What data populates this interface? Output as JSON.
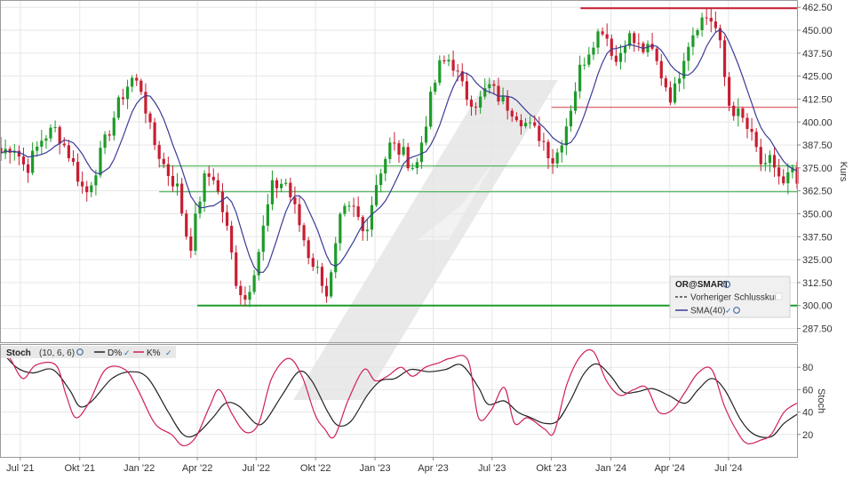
{
  "chart_data": [
    {
      "type": "candlestick",
      "title": "",
      "ylabel": "Kurs",
      "ylim": [
        280,
        466
      ],
      "yticks": [
        287.5,
        300,
        312.5,
        325,
        337.5,
        350,
        362.5,
        375,
        387.5,
        400,
        412.5,
        425,
        437.5,
        450,
        462.5
      ],
      "ytick_labels": [
        "287.50",
        "300.00",
        "312.50",
        "325.00",
        "337.50",
        "350.00",
        "362.50",
        "375.00",
        "387.50",
        "400.00",
        "412.50",
        "425.00",
        "437.50",
        "450.00",
        "462.50"
      ],
      "x_range": [
        "2021-06-01",
        "2024-10-15"
      ],
      "xticks": [
        {
          "date": "2021-07-01",
          "label": "Jul '21"
        },
        {
          "date": "2021-10-01",
          "label": "Okt '21"
        },
        {
          "date": "2022-01-01",
          "label": "Jan '22"
        },
        {
          "date": "2022-04-01",
          "label": "Apr '22"
        },
        {
          "date": "2022-07-01",
          "label": "Jul '22"
        },
        {
          "date": "2022-10-01",
          "label": "Okt '22"
        },
        {
          "date": "2023-01-01",
          "label": "Jan '23"
        },
        {
          "date": "2023-04-01",
          "label": "Apr '23"
        },
        {
          "date": "2023-07-01",
          "label": "Jul '23"
        },
        {
          "date": "2023-10-01",
          "label": "Okt '23"
        },
        {
          "date": "2024-01-01",
          "label": "Jan '24"
        },
        {
          "date": "2024-04-01",
          "label": "Apr '24"
        },
        {
          "date": "2024-07-01",
          "label": "Jul '24"
        }
      ],
      "grid": true,
      "legend": {
        "position": "bottom-right",
        "title": "OR@SMART",
        "items": [
          {
            "name": "Vorheriger Schlusskurs",
            "style": "dashed",
            "color": "#444444"
          },
          {
            "name": "SMA(40)",
            "style": "solid",
            "color": "#3b3b96"
          }
        ]
      },
      "series_colors": {
        "up": "#1e9b2a",
        "down": "#c81e32",
        "sma": "#3b3b96"
      },
      "weekly_close_waypoints": [
        [
          "2021-06-01",
          383
        ],
        [
          "2021-06-20",
          388
        ],
        [
          "2021-07-10",
          374
        ],
        [
          "2021-08-05",
          392
        ],
        [
          "2021-08-25",
          396
        ],
        [
          "2021-09-15",
          382
        ],
        [
          "2021-10-10",
          360
        ],
        [
          "2021-10-25",
          374
        ],
        [
          "2021-11-20",
          400
        ],
        [
          "2021-12-05",
          414
        ],
        [
          "2021-12-20",
          424
        ],
        [
          "2022-01-05",
          418
        ],
        [
          "2022-01-20",
          392
        ],
        [
          "2022-02-10",
          375
        ],
        [
          "2022-03-01",
          364
        ],
        [
          "2022-03-20",
          330
        ],
        [
          "2022-04-10",
          368
        ],
        [
          "2022-04-25",
          372
        ],
        [
          "2022-05-15",
          345
        ],
        [
          "2022-06-01",
          312
        ],
        [
          "2022-06-15",
          303
        ],
        [
          "2022-07-05",
          330
        ],
        [
          "2022-07-25",
          364
        ],
        [
          "2022-08-15",
          368
        ],
        [
          "2022-09-01",
          350
        ],
        [
          "2022-09-20",
          328
        ],
        [
          "2022-10-10",
          315
        ],
        [
          "2022-10-20",
          305
        ],
        [
          "2022-11-10",
          350
        ],
        [
          "2022-12-01",
          352
        ],
        [
          "2022-12-15",
          338
        ],
        [
          "2023-01-05",
          370
        ],
        [
          "2023-01-25",
          388
        ],
        [
          "2023-02-15",
          382
        ],
        [
          "2023-03-05",
          374
        ],
        [
          "2023-03-25",
          408
        ],
        [
          "2023-04-10",
          430
        ],
        [
          "2023-04-28",
          435
        ],
        [
          "2023-05-20",
          415
        ],
        [
          "2023-06-10",
          410
        ],
        [
          "2023-06-25",
          420
        ],
        [
          "2023-07-15",
          412
        ],
        [
          "2023-08-05",
          406
        ],
        [
          "2023-08-25",
          398
        ],
        [
          "2023-09-15",
          392
        ],
        [
          "2023-10-05",
          378
        ],
        [
          "2023-10-25",
          400
        ],
        [
          "2023-11-15",
          430
        ],
        [
          "2023-12-05",
          445
        ],
        [
          "2023-12-20",
          452
        ],
        [
          "2024-01-10",
          432
        ],
        [
          "2024-01-25",
          448
        ],
        [
          "2024-02-15",
          440
        ],
        [
          "2024-03-05",
          438
        ],
        [
          "2024-03-20",
          425
        ],
        [
          "2024-04-05",
          412
        ],
        [
          "2024-04-25",
          440
        ],
        [
          "2024-05-15",
          455
        ],
        [
          "2024-06-01",
          458
        ],
        [
          "2024-06-15",
          448
        ],
        [
          "2024-07-01",
          410
        ],
        [
          "2024-07-25",
          400
        ],
        [
          "2024-08-10",
          388
        ],
        [
          "2024-08-25",
          372
        ],
        [
          "2024-09-05",
          380
        ],
        [
          "2024-09-15",
          372
        ],
        [
          "2024-09-25",
          364
        ],
        [
          "2024-10-05",
          374
        ],
        [
          "2024-10-15",
          366
        ]
      ],
      "horizontal_lines": [
        {
          "value": 462,
          "from": "2023-11-15",
          "to": "2024-10-15",
          "color": "#c81e32",
          "width": 2
        },
        {
          "value": 408,
          "from": "2023-10-01",
          "to": "2024-10-15",
          "color": "#d23c4a",
          "width": 1
        },
        {
          "value": 376,
          "from": "2022-02-01",
          "to": "2024-10-15",
          "color": "#2ea83a",
          "width": 1
        },
        {
          "value": 362,
          "from": "2022-02-01",
          "to": "2024-10-15",
          "color": "#2ea83a",
          "width": 1
        },
        {
          "value": 300,
          "from": "2022-04-01",
          "to": "2024-10-15",
          "color": "#1e9b2a",
          "width": 2
        }
      ]
    },
    {
      "type": "line",
      "title": "Stoch",
      "params": "(10, 6, 6)",
      "ylabel": "Stoch",
      "ylim": [
        0,
        100
      ],
      "yticks": [
        20,
        40,
        60,
        80
      ],
      "ytick_labels": [
        "20",
        "40",
        "60",
        "80"
      ],
      "legend": {
        "position": "top-left",
        "items": [
          "D%",
          "K%"
        ]
      },
      "series": [
        {
          "name": "D%",
          "color": "#222222",
          "waypoints": [
            [
              "2021-06-01",
              95
            ],
            [
              "2021-06-25",
              80
            ],
            [
              "2021-07-20",
              75
            ],
            [
              "2021-08-20",
              78
            ],
            [
              "2021-09-15",
              60
            ],
            [
              "2021-10-01",
              45
            ],
            [
              "2021-10-20",
              50
            ],
            [
              "2021-11-20",
              70
            ],
            [
              "2021-12-20",
              76
            ],
            [
              "2022-01-15",
              70
            ],
            [
              "2022-02-15",
              40
            ],
            [
              "2022-03-10",
              20
            ],
            [
              "2022-03-30",
              20
            ],
            [
              "2022-04-25",
              35
            ],
            [
              "2022-05-15",
              48
            ],
            [
              "2022-06-05",
              45
            ],
            [
              "2022-06-30",
              30
            ],
            [
              "2022-07-15",
              32
            ],
            [
              "2022-08-10",
              55
            ],
            [
              "2022-09-05",
              76
            ],
            [
              "2022-09-25",
              68
            ],
            [
              "2022-10-20",
              40
            ],
            [
              "2022-11-05",
              28
            ],
            [
              "2022-11-25",
              32
            ],
            [
              "2022-12-20",
              55
            ],
            [
              "2023-01-10",
              68
            ],
            [
              "2023-02-01",
              70
            ],
            [
              "2023-02-25",
              78
            ],
            [
              "2023-03-25",
              76
            ],
            [
              "2023-04-20",
              78
            ],
            [
              "2023-05-15",
              82
            ],
            [
              "2023-06-10",
              62
            ],
            [
              "2023-06-25",
              47
            ],
            [
              "2023-07-20",
              50
            ],
            [
              "2023-08-10",
              40
            ],
            [
              "2023-08-30",
              35
            ],
            [
              "2023-09-20",
              30
            ],
            [
              "2023-10-10",
              32
            ],
            [
              "2023-10-30",
              50
            ],
            [
              "2023-11-20",
              74
            ],
            [
              "2023-12-10",
              83
            ],
            [
              "2024-01-01",
              72
            ],
            [
              "2024-01-20",
              58
            ],
            [
              "2024-02-10",
              58
            ],
            [
              "2024-03-05",
              61
            ],
            [
              "2024-03-30",
              55
            ],
            [
              "2024-04-25",
              48
            ],
            [
              "2024-05-15",
              60
            ],
            [
              "2024-06-05",
              70
            ],
            [
              "2024-06-25",
              60
            ],
            [
              "2024-07-20",
              33
            ],
            [
              "2024-08-10",
              20
            ],
            [
              "2024-09-05",
              18
            ],
            [
              "2024-09-25",
              30
            ],
            [
              "2024-10-15",
              38
            ]
          ]
        },
        {
          "name": "K%",
          "color": "#d01e5a",
          "waypoints": [
            [
              "2021-06-01",
              96
            ],
            [
              "2021-06-15",
              88
            ],
            [
              "2021-07-05",
              70
            ],
            [
              "2021-07-25",
              82
            ],
            [
              "2021-08-25",
              82
            ],
            [
              "2021-09-10",
              55
            ],
            [
              "2021-09-25",
              35
            ],
            [
              "2021-10-15",
              48
            ],
            [
              "2021-11-10",
              78
            ],
            [
              "2021-12-10",
              78
            ],
            [
              "2021-12-30",
              60
            ],
            [
              "2022-01-25",
              30
            ],
            [
              "2022-02-20",
              20
            ],
            [
              "2022-03-10",
              10
            ],
            [
              "2022-03-30",
              18
            ],
            [
              "2022-04-20",
              45
            ],
            [
              "2022-05-05",
              60
            ],
            [
              "2022-05-25",
              38
            ],
            [
              "2022-06-15",
              22
            ],
            [
              "2022-07-05",
              30
            ],
            [
              "2022-07-25",
              70
            ],
            [
              "2022-08-20",
              88
            ],
            [
              "2022-09-10",
              72
            ],
            [
              "2022-09-30",
              38
            ],
            [
              "2022-10-15",
              25
            ],
            [
              "2022-10-30",
              18
            ],
            [
              "2022-11-20",
              50
            ],
            [
              "2022-12-15",
              78
            ],
            [
              "2023-01-01",
              68
            ],
            [
              "2023-01-20",
              72
            ],
            [
              "2023-02-10",
              80
            ],
            [
              "2023-02-28",
              72
            ],
            [
              "2023-03-20",
              80
            ],
            [
              "2023-04-10",
              84
            ],
            [
              "2023-04-28",
              88
            ],
            [
              "2023-05-25",
              86
            ],
            [
              "2023-06-10",
              35
            ],
            [
              "2023-06-30",
              42
            ],
            [
              "2023-07-20",
              62
            ],
            [
              "2023-08-05",
              30
            ],
            [
              "2023-08-25",
              35
            ],
            [
              "2023-09-20",
              25
            ],
            [
              "2023-10-05",
              22
            ],
            [
              "2023-10-25",
              65
            ],
            [
              "2023-11-15",
              90
            ],
            [
              "2023-12-05",
              94
            ],
            [
              "2023-12-25",
              68
            ],
            [
              "2024-01-15",
              55
            ],
            [
              "2024-02-05",
              60
            ],
            [
              "2024-02-25",
              62
            ],
            [
              "2024-03-15",
              40
            ],
            [
              "2024-04-05",
              42
            ],
            [
              "2024-04-25",
              58
            ],
            [
              "2024-05-15",
              75
            ],
            [
              "2024-06-05",
              78
            ],
            [
              "2024-06-25",
              45
            ],
            [
              "2024-07-15",
              22
            ],
            [
              "2024-07-30",
              12
            ],
            [
              "2024-08-20",
              15
            ],
            [
              "2024-09-05",
              20
            ],
            [
              "2024-09-25",
              40
            ],
            [
              "2024-10-15",
              48
            ]
          ]
        }
      ]
    }
  ],
  "colors": {
    "grid": "#e6e6e6",
    "frame": "#9a9a9a",
    "panel_bg": "#ffffff",
    "label_bg": "#e8e8e8"
  },
  "icons": {
    "settings": "gear-icon",
    "visible": "check-icon"
  }
}
